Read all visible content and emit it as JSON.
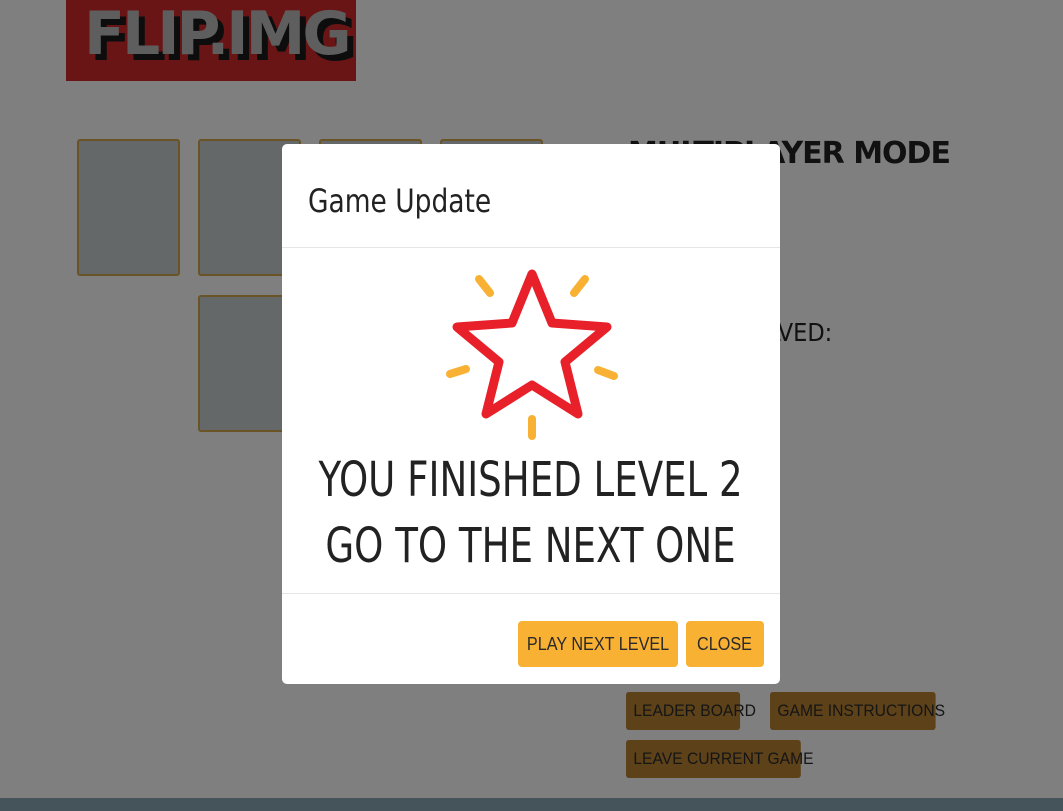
{
  "app": {
    "logo_text": "FLIP.IMG",
    "mode_title": "MULTIPLAYER MODE",
    "info_label": "LEVEL SOLVED:"
  },
  "board": {
    "cards": [
      {
        "state": "face-down"
      },
      {
        "state": "face-down"
      },
      {
        "state": "face-down"
      },
      {
        "state": "face-down"
      },
      {
        "state": "face-down"
      }
    ]
  },
  "menu": {
    "leader_board": "LEADER BOARD",
    "game_instructions": "GAME INSTRUCTIONS",
    "leave_game": "LEAVE CURRENT GAME"
  },
  "modal": {
    "title": "Game Update",
    "icon": "star-icon",
    "message_line1": "YOU FINISHED LEVEL 2",
    "message_line2": "GO TO THE NEXT ONE",
    "play_next_label": "PLAY NEXT LEVEL",
    "close_label": "CLOSE"
  },
  "colors": {
    "logo_bg": "#d32a2a",
    "card_border": "#d4a64a",
    "menu_button": "#b98233",
    "modal_button": "#f8b133",
    "star_red": "#e8202a",
    "sparkle": "#f8b133"
  }
}
